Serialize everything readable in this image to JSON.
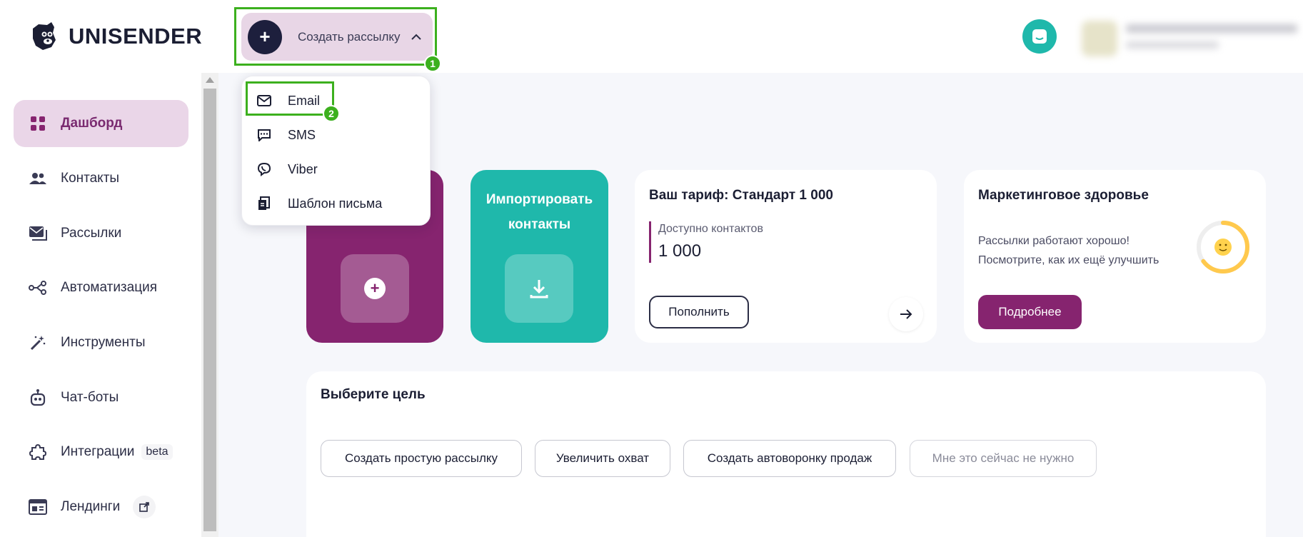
{
  "app": {
    "logo_text": "UNISENDER"
  },
  "header": {
    "create_button_label": "Создать рассылку",
    "badge_1": "1",
    "badge_2": "2"
  },
  "dropdown": {
    "items": [
      {
        "label": "Email",
        "icon": "envelope-icon"
      },
      {
        "label": "SMS",
        "icon": "sms-chat-icon"
      },
      {
        "label": "Viber",
        "icon": "viber-icon"
      },
      {
        "label": "Шаблон письма",
        "icon": "template-icon"
      }
    ]
  },
  "sidebar": {
    "items": [
      {
        "label": "Дашборд",
        "icon": "dashboard-icon",
        "active": true
      },
      {
        "label": "Контакты",
        "icon": "users-icon"
      },
      {
        "label": "Рассылки",
        "icon": "mail-stack-icon"
      },
      {
        "label": "Автоматизация",
        "icon": "automation-icon"
      },
      {
        "label": "Инструменты",
        "icon": "magic-wand-icon"
      },
      {
        "label": "Чат-боты",
        "icon": "robot-icon"
      },
      {
        "label": "Интеграции",
        "icon": "puzzle-icon",
        "tag": "beta"
      },
      {
        "label": "Лендинги",
        "icon": "landing-icon",
        "external": true
      }
    ]
  },
  "cards": {
    "import": {
      "title_line1": "Импортировать",
      "title_line2": "контакты"
    },
    "tariff": {
      "title": "Ваш тариф: Стандарт 1 000",
      "contacts_label": "Доступно контактов",
      "contacts_value": "1 000",
      "topup_label": "Пополнить"
    },
    "health": {
      "title": "Маркетинговое здоровье",
      "text_line1": "Рассылки работают хорошо!",
      "text_line2": "Посмотрите, как их ещё улучшить",
      "more_label": "Подробнее",
      "gauge_level": 0.65
    }
  },
  "goal": {
    "title": "Выберите цель",
    "options": [
      "Создать простую рассылку",
      "Увеличить охват",
      "Создать автоворонку продаж",
      "Мне это сейчас не нужно"
    ]
  },
  "colors": {
    "brand_purple": "#86246f",
    "teal": "#1fb8ab",
    "highlight_green": "#3cb01e",
    "navy": "#1d1f3d"
  }
}
